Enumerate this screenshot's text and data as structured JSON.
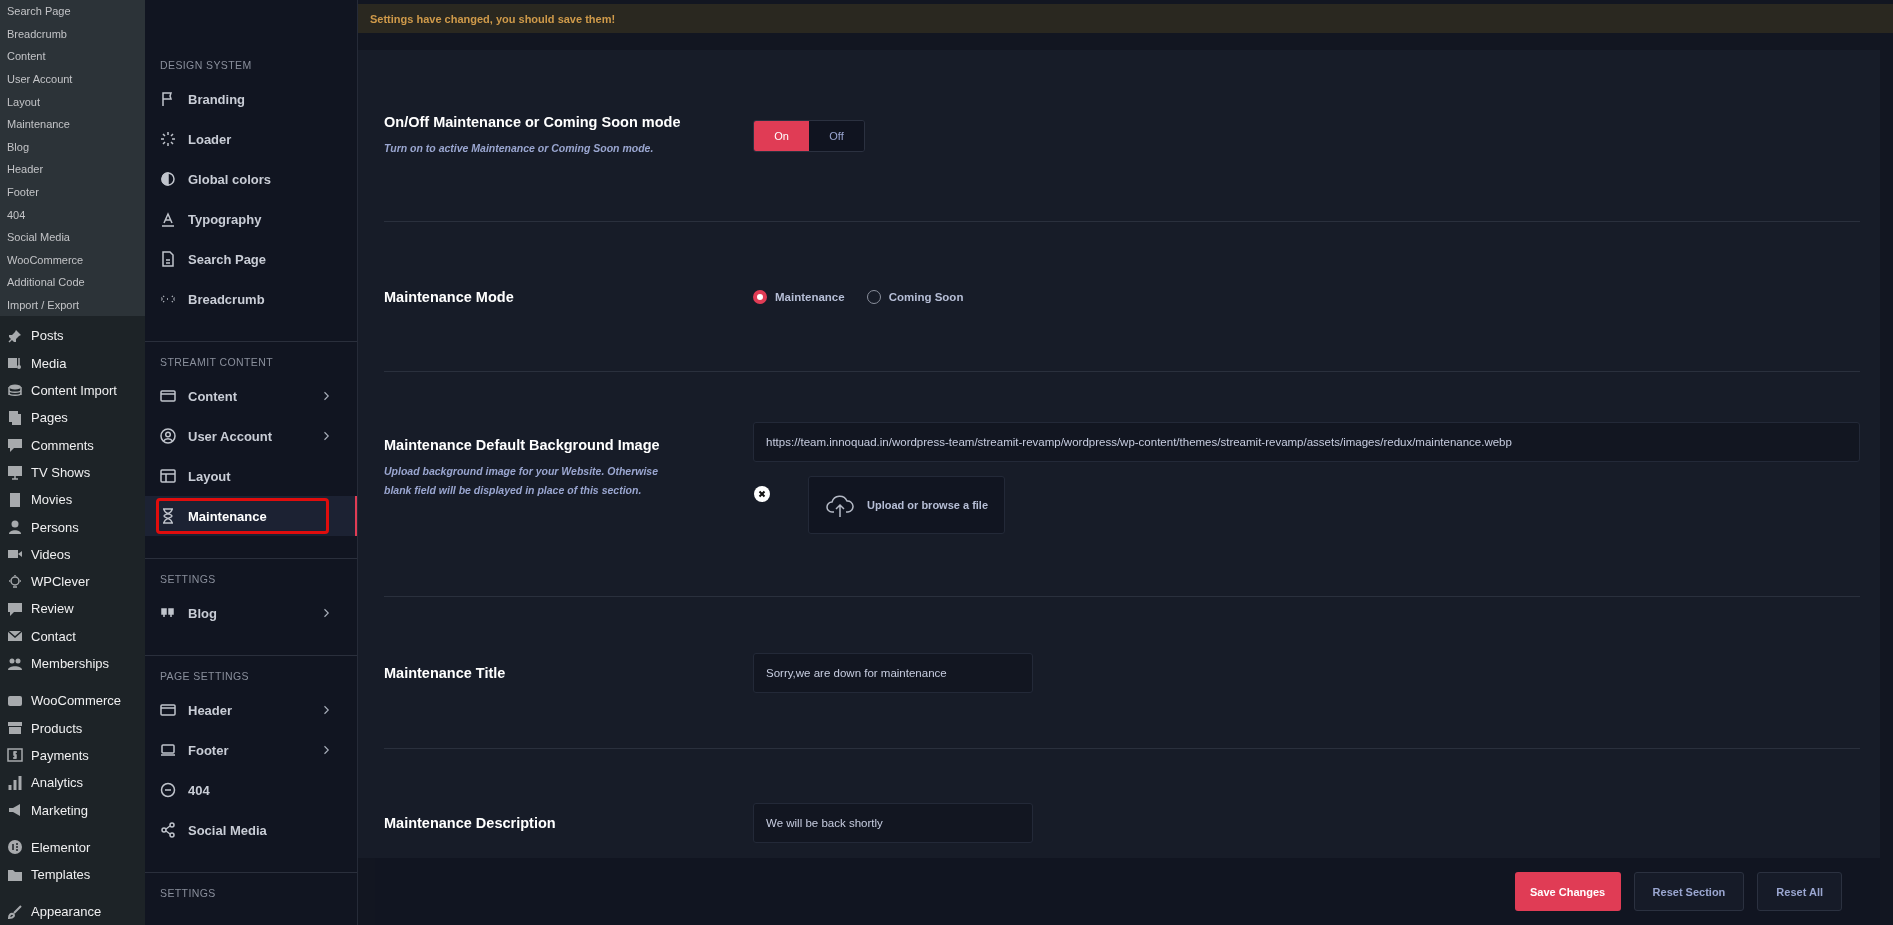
{
  "admin_menu": {
    "submenu": [
      "Search Page",
      "Breadcrumb",
      "Content",
      "User Account",
      "Layout",
      "Maintenance",
      "Blog",
      "Header",
      "Footer",
      "404",
      "Social Media",
      "WooCommerce",
      "Additional Code",
      "Import / Export"
    ],
    "groups": [
      [
        "Posts",
        "Media",
        "Content Import",
        "Pages",
        "Comments",
        "TV Shows",
        "Movies",
        "Persons",
        "Videos",
        "WPClever",
        "Review",
        "Contact",
        "Memberships"
      ],
      [
        "WooCommerce",
        "Products",
        "Payments",
        "Analytics",
        "Marketing"
      ],
      [
        "Elementor",
        "Templates"
      ],
      [
        "Appearance"
      ]
    ]
  },
  "options_nav": {
    "sections": [
      {
        "heading": "DESIGN SYSTEM",
        "items": [
          {
            "label": "Branding",
            "has_submenu": false,
            "selected": false
          },
          {
            "label": "Loader",
            "has_submenu": false,
            "selected": false
          },
          {
            "label": "Global colors",
            "has_submenu": false,
            "selected": false
          },
          {
            "label": "Typography",
            "has_submenu": false,
            "selected": false
          },
          {
            "label": "Search Page",
            "has_submenu": false,
            "selected": false
          },
          {
            "label": "Breadcrumb",
            "has_submenu": false,
            "selected": false
          }
        ]
      },
      {
        "heading": "STREAMIT CONTENT",
        "items": [
          {
            "label": "Content",
            "has_submenu": true,
            "selected": false
          },
          {
            "label": "User Account",
            "has_submenu": true,
            "selected": false
          },
          {
            "label": "Layout",
            "has_submenu": false,
            "selected": false
          },
          {
            "label": "Maintenance",
            "has_submenu": false,
            "selected": true
          }
        ]
      },
      {
        "heading": "SETTINGS",
        "items": [
          {
            "label": "Blog",
            "has_submenu": true,
            "selected": false
          }
        ]
      },
      {
        "heading": "PAGE SETTINGS",
        "items": [
          {
            "label": "Header",
            "has_submenu": true,
            "selected": false
          },
          {
            "label": "Footer",
            "has_submenu": true,
            "selected": false
          },
          {
            "label": "404",
            "has_submenu": false,
            "selected": false
          },
          {
            "label": "Social Media",
            "has_submenu": false,
            "selected": false
          }
        ]
      },
      {
        "heading": "SETTINGS"
      }
    ]
  },
  "notice": "Settings have changed, you should save them!",
  "fields": [
    {
      "kind": "toggle",
      "title": "On/Off Maintenance or Coming Soon mode",
      "description": "Turn on to active Maintenance or Coming Soon mode.",
      "options": [
        {
          "label": "On",
          "selected": true
        },
        {
          "label": "Off",
          "selected": false
        }
      ]
    },
    {
      "kind": "radio",
      "title": "Maintenance Mode",
      "options": [
        {
          "label": "Maintenance",
          "selected": true
        },
        {
          "label": "Coming Soon",
          "selected": false
        }
      ]
    },
    {
      "kind": "media",
      "title": "Maintenance Default Background Image",
      "description": "Upload background image for your Website. Otherwise blank field will be displayed in place of this section.",
      "value": "https://team.innoquad.in/wordpress-team/streamit-revamp/wordpress/wp-content/themes/streamit-revamp/assets/images/redux/maintenance.webp",
      "upload_label": "Upload or browse a file"
    },
    {
      "kind": "text",
      "title": "Maintenance Title",
      "value": "Sorry,we are down for maintenance"
    },
    {
      "kind": "text",
      "title": "Maintenance Description",
      "value": "We will be back shortly"
    }
  ],
  "footer_buttons": [
    {
      "label": "Save Changes",
      "kind": "primary"
    },
    {
      "label": "Reset Section",
      "kind": "secondary"
    },
    {
      "label": "Reset All",
      "kind": "secondary"
    }
  ]
}
